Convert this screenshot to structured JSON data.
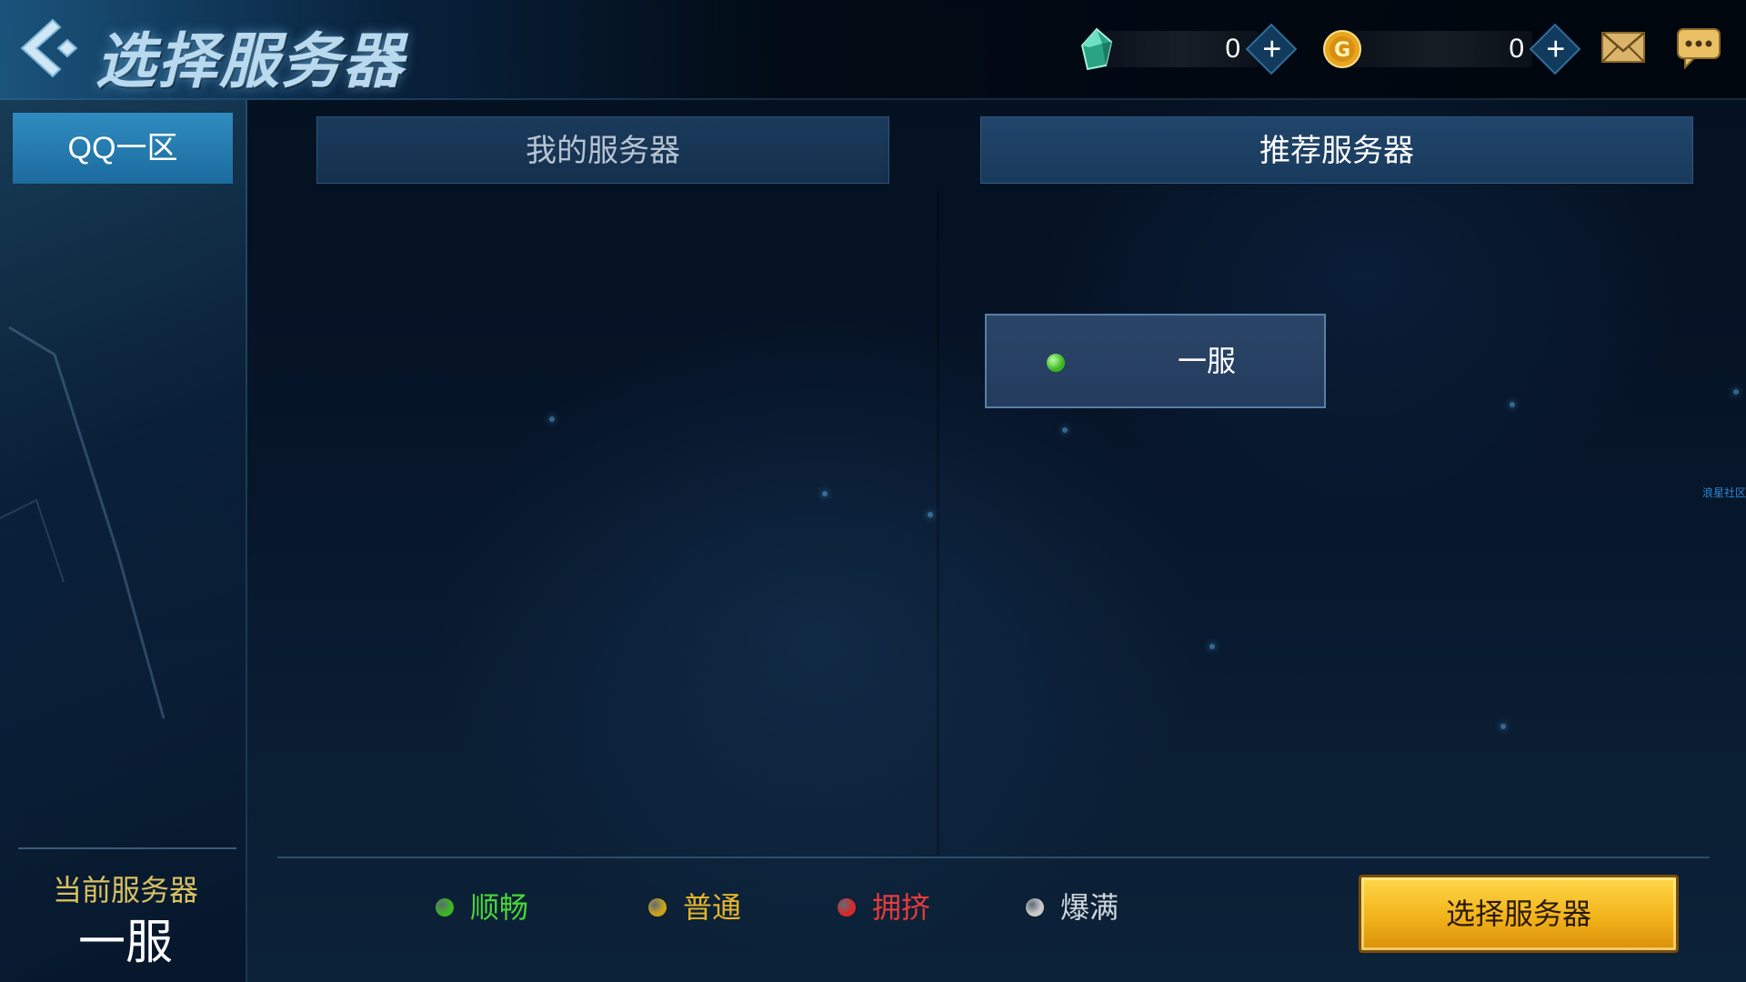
{
  "header": {
    "title": "选择服务器",
    "gems": {
      "value": "0",
      "icon": "gem-icon",
      "plus_label": "+"
    },
    "gold": {
      "value": "0",
      "icon": "gold-coin-icon",
      "plus_label": "+"
    },
    "mail_icon": "mail-icon",
    "chat_icon": "chat-icon"
  },
  "sidebar": {
    "zone_tab": "QQ一区",
    "current_label": "当前服务器",
    "current_value": "一服"
  },
  "tabs": {
    "my_servers": "我的服务器",
    "recommended": "推荐服务器"
  },
  "servers": [
    {
      "name": "一服",
      "status": "smooth"
    }
  ],
  "side_note": "浪星社区",
  "legend": [
    {
      "label": "顺畅",
      "color": "#3cb521",
      "text_color": "#4ad43a"
    },
    {
      "label": "普通",
      "color": "#c9a31a",
      "text_color": "#e6b62a"
    },
    {
      "label": "拥挤",
      "color": "#d42a2a",
      "text_color": "#e63b3b"
    },
    {
      "label": "爆满",
      "color": "#c8c8c8",
      "text_color": "#cfd6dd"
    }
  ],
  "footer": {
    "select_button": "选择服务器"
  }
}
